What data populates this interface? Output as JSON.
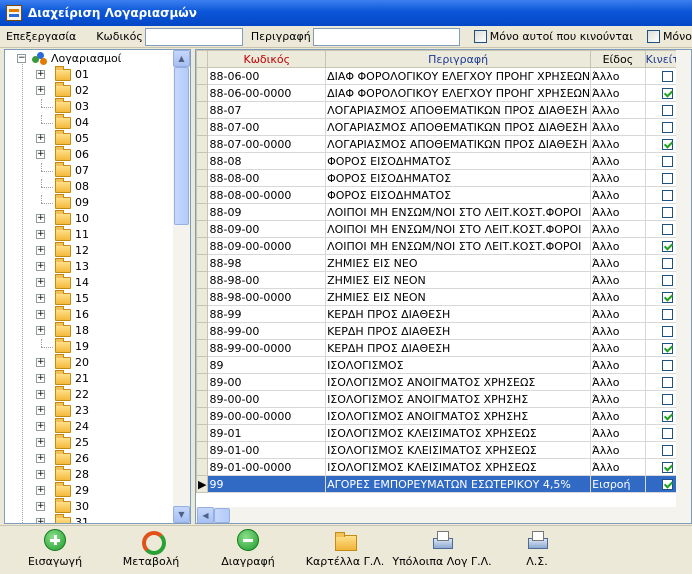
{
  "window": {
    "title": "Διαχείριση Λογαριασμών"
  },
  "toolbar": {
    "menu_label": "Επεξεργασία",
    "code_label": "Κωδικός",
    "code_value": "",
    "desc_label": "Περιγραφή",
    "desc_value": "",
    "only_moving_label": "Μόνο αυτοί που κινούνται",
    "only_other_label": "Μόνο Εν"
  },
  "tree": {
    "root_label": "Λογαριασμοί",
    "items": [
      {
        "label": "01",
        "expandable": true
      },
      {
        "label": "02",
        "expandable": true
      },
      {
        "label": "03",
        "expandable": false
      },
      {
        "label": "04",
        "expandable": false
      },
      {
        "label": "05",
        "expandable": true
      },
      {
        "label": "06",
        "expandable": true
      },
      {
        "label": "07",
        "expandable": false
      },
      {
        "label": "08",
        "expandable": false
      },
      {
        "label": "09",
        "expandable": false
      },
      {
        "label": "10",
        "expandable": true
      },
      {
        "label": "11",
        "expandable": true
      },
      {
        "label": "12",
        "expandable": true
      },
      {
        "label": "13",
        "expandable": true
      },
      {
        "label": "14",
        "expandable": true
      },
      {
        "label": "15",
        "expandable": true
      },
      {
        "label": "16",
        "expandable": true
      },
      {
        "label": "18",
        "expandable": true
      },
      {
        "label": "19",
        "expandable": false
      },
      {
        "label": "20",
        "expandable": true
      },
      {
        "label": "21",
        "expandable": true
      },
      {
        "label": "22",
        "expandable": true
      },
      {
        "label": "23",
        "expandable": true
      },
      {
        "label": "24",
        "expandable": true
      },
      {
        "label": "25",
        "expandable": true
      },
      {
        "label": "26",
        "expandable": true
      },
      {
        "label": "28",
        "expandable": true
      },
      {
        "label": "29",
        "expandable": true
      },
      {
        "label": "30",
        "expandable": true
      },
      {
        "label": "31",
        "expandable": true
      }
    ]
  },
  "grid": {
    "columns": [
      "Κωδικός",
      "Περιγραφή",
      "Είδος",
      "Κινείται"
    ],
    "column_colors": [
      "#c00000",
      "#1f3a93",
      "#000000",
      "#1f3a93"
    ],
    "rows": [
      {
        "code": "88-06-00",
        "desc": "ΔΙΑΦ ΦΟΡΟΛΟΓΙΚΟΥ ΕΛΕΓΧΟΥ ΠΡΟΗΓ ΧΡΗΣΕΩΝ",
        "type": "Άλλο",
        "moving": false
      },
      {
        "code": "88-06-00-0000",
        "desc": "ΔΙΑΦ ΦΟΡΟΛΟΓΙΚΟΥ ΕΛΕΓΧΟΥ ΠΡΟΗΓ ΧΡΗΣΕΩΝ",
        "type": "Άλλο",
        "moving": true
      },
      {
        "code": "88-07",
        "desc": "ΛΟΓΑΡΙΑΣΜΟΣ ΑΠΟΘΕΜΑΤΙΚΩΝ ΠΡΟΣ ΔΙΑΘΕΣΗ",
        "type": "Άλλο",
        "moving": false
      },
      {
        "code": "88-07-00",
        "desc": "ΛΟΓΑΡΙΑΣΜΟΣ ΑΠΟΘΕΜΑΤΙΚΩΝ ΠΡΟΣ ΔΙΑΘΕΣΗ",
        "type": "Άλλο",
        "moving": false
      },
      {
        "code": "88-07-00-0000",
        "desc": "ΛΟΓΑΡΙΑΣΜΟΣ ΑΠΟΘΕΜΑΤΙΚΩΝ ΠΡΟΣ ΔΙΑΘΕΣΗ",
        "type": "Άλλο",
        "moving": true
      },
      {
        "code": "88-08",
        "desc": "ΦΟΡΟΣ ΕΙΣΟΔΗΜΑΤΟΣ",
        "type": "Άλλο",
        "moving": false
      },
      {
        "code": "88-08-00",
        "desc": "ΦΟΡΟΣ ΕΙΣΟΔΗΜΑΤΟΣ",
        "type": "Άλλο",
        "moving": false
      },
      {
        "code": "88-08-00-0000",
        "desc": "ΦΟΡΟΣ ΕΙΣΟΔΗΜΑΤΟΣ",
        "type": "Άλλο",
        "moving": false
      },
      {
        "code": "88-09",
        "desc": "ΛΟΙΠΟΙ ΜΗ ΕΝΣΩΜ/ΝΟΙ ΣΤΟ ΛΕΙΤ.ΚΟΣΤ.ΦΟΡΟΙ",
        "type": "Άλλο",
        "moving": false
      },
      {
        "code": "88-09-00",
        "desc": "ΛΟΙΠΟΙ ΜΗ ΕΝΣΩΜ/ΝΟΙ ΣΤΟ ΛΕΙΤ.ΚΟΣΤ.ΦΟΡΟΙ",
        "type": "Άλλο",
        "moving": false
      },
      {
        "code": "88-09-00-0000",
        "desc": "ΛΟΙΠΟΙ ΜΗ ΕΝΣΩΜ/ΝΟΙ ΣΤΟ ΛΕΙΤ.ΚΟΣΤ.ΦΟΡΟΙ",
        "type": "Άλλο",
        "moving": true
      },
      {
        "code": "88-98",
        "desc": "ΖΗΜΙΕΣ ΕΙΣ ΝΕΟ",
        "type": "Άλλο",
        "moving": false
      },
      {
        "code": "88-98-00",
        "desc": "ΖΗΜΙΕΣ ΕΙΣ ΝΕΟΝ",
        "type": "Άλλο",
        "moving": false
      },
      {
        "code": "88-98-00-0000",
        "desc": "ΖΗΜΙΕΣ ΕΙΣ ΝΕΟΝ",
        "type": "Άλλο",
        "moving": true
      },
      {
        "code": "88-99",
        "desc": "ΚΕΡΔΗ ΠΡΟΣ ΔΙΑΘΕΣΗ",
        "type": "Άλλο",
        "moving": false
      },
      {
        "code": "88-99-00",
        "desc": "ΚΕΡΔΗ ΠΡΟΣ ΔΙΑΘΕΣΗ",
        "type": "Άλλο",
        "moving": false
      },
      {
        "code": "88-99-00-0000",
        "desc": "ΚΕΡΔΗ ΠΡΟΣ ΔΙΑΘΕΣΗ",
        "type": "Άλλο",
        "moving": true
      },
      {
        "code": "89",
        "desc": "ΙΣΟΛΟΓΙΣΜΟΣ",
        "type": "Άλλο",
        "moving": false
      },
      {
        "code": "89-00",
        "desc": "ΙΣΟΛΟΓΙΣΜΟΣ ΑΝΟΙΓΜΑΤΟΣ ΧΡΗΣΕΩΣ",
        "type": "Άλλο",
        "moving": false
      },
      {
        "code": "89-00-00",
        "desc": "ΙΣΟΛΟΓΙΣΜΟΣ ΑΝΟΙΓΜΑΤΟΣ ΧΡΗΣΗΣ",
        "type": "Άλλο",
        "moving": false
      },
      {
        "code": "89-00-00-0000",
        "desc": "ΙΣΟΛΟΓΙΣΜΟΣ ΑΝΟΙΓΜΑΤΟΣ ΧΡΗΣΗΣ",
        "type": "Άλλο",
        "moving": true
      },
      {
        "code": "89-01",
        "desc": "ΙΣΟΛΟΓΙΣΜΟΣ ΚΛΕΙΣΙΜΑΤΟΣ ΧΡΗΣΕΩΣ",
        "type": "Άλλο",
        "moving": false
      },
      {
        "code": "89-01-00",
        "desc": "ΙΣΟΛΟΓΙΣΜΟΣ ΚΛΕΙΣΙΜΑΤΟΣ ΧΡΗΣΕΩΣ",
        "type": "Άλλο",
        "moving": false
      },
      {
        "code": "89-01-00-0000",
        "desc": "ΙΣΟΛΟΓΙΣΜΟΣ ΚΛΕΙΣΙΜΑΤΟΣ ΧΡΗΣΕΩΣ",
        "type": "Άλλο",
        "moving": true
      },
      {
        "code": "99",
        "desc": "ΑΓΟΡΕΣ ΕΜΠΟΡΕΥΜΑΤΩΝ ΕΣΩΤΕΡΙΚΟΥ 4,5%",
        "type": "Εισροή",
        "moving": true,
        "selected": true
      }
    ]
  },
  "bottom": {
    "buttons": [
      {
        "label": "Εισαγωγή",
        "icon": "add-icon"
      },
      {
        "label": "Μεταβολή",
        "icon": "refresh-icon"
      },
      {
        "label": "Διαγραφή",
        "icon": "remove-icon"
      },
      {
        "label": "Καρτέλλα Γ.Λ.",
        "icon": "folder-icon"
      },
      {
        "label": "Υπόλοιπα Λογ Γ.Λ.",
        "icon": "printer-icon"
      },
      {
        "label": "Λ.Σ.",
        "icon": "printer-icon"
      }
    ]
  }
}
